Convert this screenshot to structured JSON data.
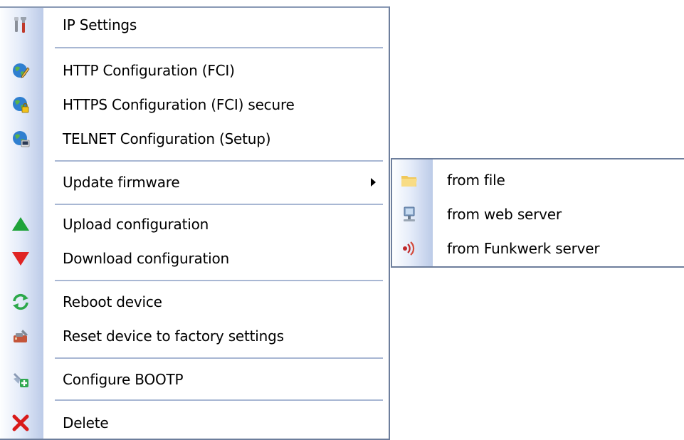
{
  "context_menu": {
    "items": [
      {
        "label": "IP Settings",
        "icon": "tools-icon"
      },
      {
        "label": "HTTP Configuration (FCI)",
        "icon": "globe-pencil-icon"
      },
      {
        "label": "HTTPS Configuration (FCI) secure",
        "icon": "globe-lock-icon"
      },
      {
        "label": "TELNET Configuration (Setup)",
        "icon": "globe-terminal-icon"
      },
      {
        "label": "Update firmware",
        "icon": "none",
        "has_submenu": true
      },
      {
        "label": "Upload configuration",
        "icon": "up-triangle-icon"
      },
      {
        "label": "Download configuration",
        "icon": "down-triangle-icon"
      },
      {
        "label": "Reboot device",
        "icon": "refresh-arrows-icon"
      },
      {
        "label": "Reset device to factory settings",
        "icon": "factory-reset-icon"
      },
      {
        "label": "Configure BOOTP",
        "icon": "bootp-config-icon"
      },
      {
        "label": "Delete",
        "icon": "red-x-icon"
      }
    ]
  },
  "submenu": {
    "items": [
      {
        "label": "from file",
        "icon": "folder-icon"
      },
      {
        "label": "from web server",
        "icon": "server-icon"
      },
      {
        "label": "from Funkwerk server",
        "icon": "funkwerk-icon"
      }
    ]
  },
  "colors": {
    "border": "#6d7e9c",
    "separator": "#a8b7d3",
    "sidebar_gradient_end": "#bccbe8",
    "up_green": "#1fa33a",
    "down_red": "#e02424",
    "delete_red": "#d91a1a"
  }
}
